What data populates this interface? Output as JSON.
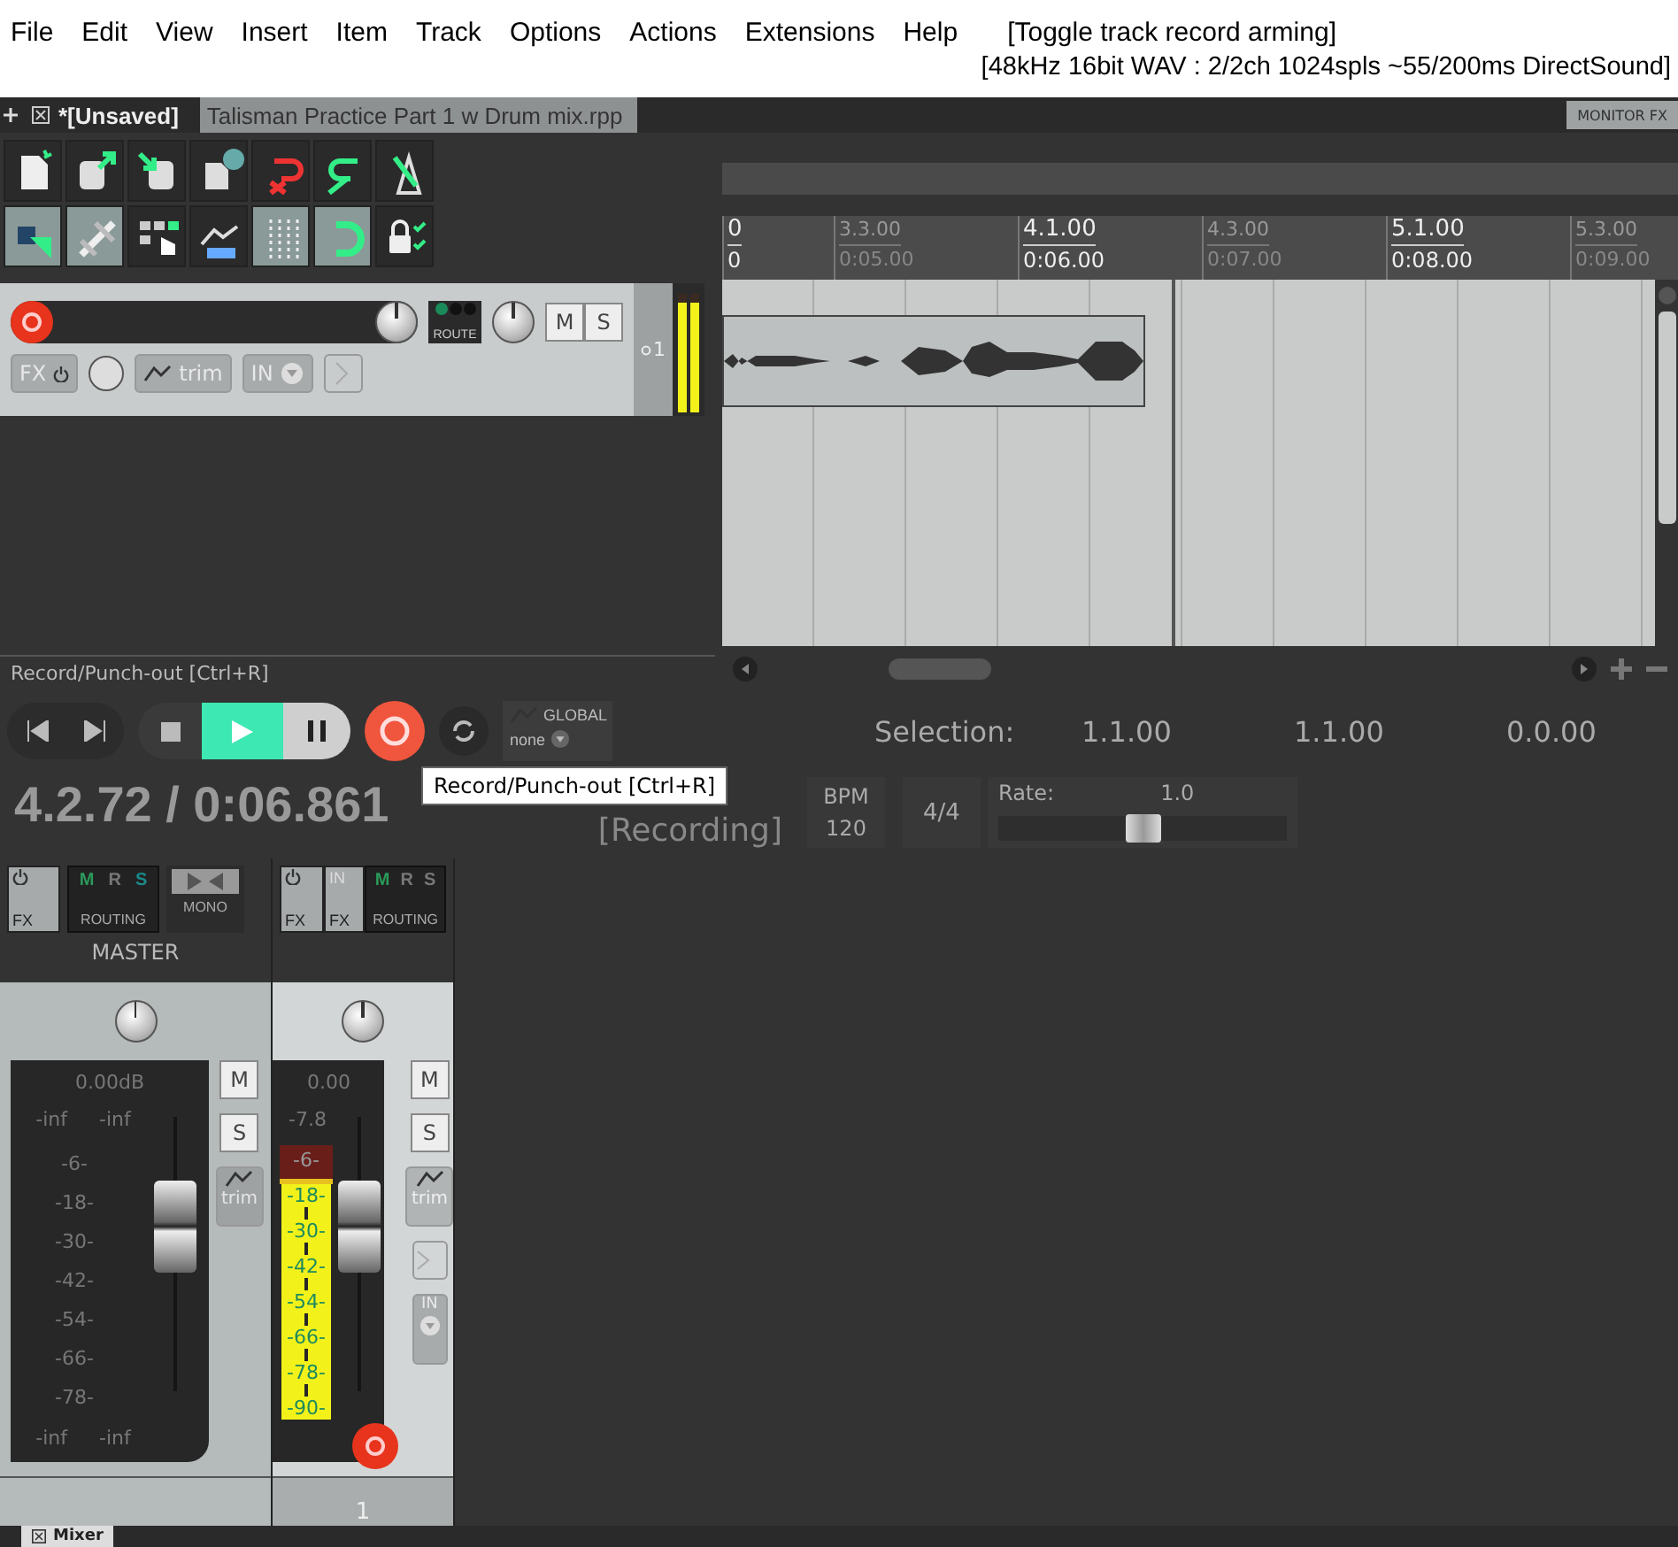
{
  "menu": [
    "File",
    "Edit",
    "View",
    "Insert",
    "Item",
    "Track",
    "Options",
    "Actions",
    "Extensions",
    "Help"
  ],
  "action_hint": "[Toggle track record arming]",
  "audio_status": "[48kHz 16bit WAV : 2/2ch 1024spls ~55/200ms DirectSound]",
  "project_tabs": [
    {
      "label": "*[Unsaved]",
      "selected": true
    },
    {
      "label": "Talisman Practice  Part 1  w  Drum mix.rpp",
      "selected": false
    }
  ],
  "monitor_fx": "MONITOR FX",
  "toolbar": [
    [
      {
        "kind": "new",
        "on": false
      },
      {
        "kind": "open",
        "on": false
      },
      {
        "kind": "save",
        "on": false
      },
      {
        "kind": "info",
        "on": false
      },
      {
        "kind": "undo",
        "on": false
      },
      {
        "kind": "redo",
        "on": false
      },
      {
        "kind": "metronome",
        "on": false
      }
    ],
    [
      {
        "kind": "ripple",
        "on": true
      },
      {
        "kind": "link",
        "on": true
      },
      {
        "kind": "select",
        "on": false
      },
      {
        "kind": "envelope",
        "on": false
      },
      {
        "kind": "grid",
        "on": true
      },
      {
        "kind": "snap",
        "on": true
      },
      {
        "kind": "lock",
        "on": false
      }
    ]
  ],
  "track": {
    "armed": true,
    "route": "ROUTE",
    "mute": "M",
    "solo": "S",
    "fx": "FX",
    "trim": "trim",
    "input": "IN",
    "number": "1",
    "meter": {
      "level": 0.92
    }
  },
  "ruler": [
    {
      "bar": "0",
      "time": "0",
      "major": true
    },
    {
      "bar": "3.3.00",
      "time": "0:05.00",
      "major": false
    },
    {
      "bar": "4.1.00",
      "time": "0:06.00",
      "major": true
    },
    {
      "bar": "4.3.00",
      "time": "0:07.00",
      "major": false
    },
    {
      "bar": "5.1.00",
      "time": "0:08.00",
      "major": true
    },
    {
      "bar": "5.3.00",
      "time": "0:09.00",
      "major": false
    }
  ],
  "status_text": "Record/Punch-out [Ctrl+R]",
  "transport": {
    "buttons": [
      {
        "kind": "start",
        "on": false
      },
      {
        "kind": "end",
        "on": false
      },
      {
        "kind": "stop",
        "on": false
      },
      {
        "kind": "play",
        "on": true
      },
      {
        "kind": "pause",
        "on": false
      },
      {
        "kind": "record",
        "on": true
      },
      {
        "kind": "repeat",
        "on": false
      }
    ],
    "automation_label": "GLOBAL",
    "automation_value": "none"
  },
  "selection": {
    "label": "Selection:",
    "start": "1.1.00",
    "end": "1.1.00",
    "length": "0.0.00"
  },
  "position": "4.2.72 / 0:06.861",
  "play_state": "[Recording]",
  "bpm": {
    "label": "BPM",
    "value": "120"
  },
  "time_signature": "4/4",
  "rate": {
    "label": "Rate:",
    "value": "1.0",
    "level": 0.5
  },
  "tooltip": "Record/Punch-out [Ctrl+R]",
  "mixer": {
    "master": {
      "name": "MASTER",
      "fx": "FX",
      "mono": "MONO",
      "routing": "ROUTING",
      "letters": [
        {
          "text": "M",
          "on": true
        },
        {
          "text": "R",
          "on": false
        },
        {
          "text": "S",
          "on": true
        }
      ],
      "volume": "0.00dB",
      "peaks": [
        "-inf",
        "-inf"
      ],
      "scale": [
        "-6-",
        "-18-",
        "-30-",
        "-42-",
        "-54-",
        "-66-",
        "-78-"
      ],
      "floor": [
        "-inf",
        "-inf"
      ],
      "mute": "M",
      "solo": "S",
      "trim": "trim",
      "fader": {
        "level": 0.6
      }
    },
    "track": {
      "fx": "FX",
      "input_fx": "IN",
      "input_fx_label": "FX",
      "routing": "ROUTING",
      "letters": [
        {
          "text": "M",
          "on": true
        },
        {
          "text": "R",
          "on": false
        },
        {
          "text": "S",
          "on": false
        }
      ],
      "volume": "0.00",
      "peak": "-7.8",
      "scale": [
        "-6-",
        "-18-",
        "-30-",
        "-42-",
        "-54-",
        "-66-",
        "-78-",
        "-90-"
      ],
      "mute": "M",
      "solo": "S",
      "trim": "trim",
      "input": "IN",
      "armed": true,
      "number": "1",
      "meter": {
        "level": 0.92
      },
      "fader": {
        "level": 0.6
      }
    }
  },
  "bottom_tabs": [
    {
      "label": "Mixer",
      "selected": true
    }
  ]
}
